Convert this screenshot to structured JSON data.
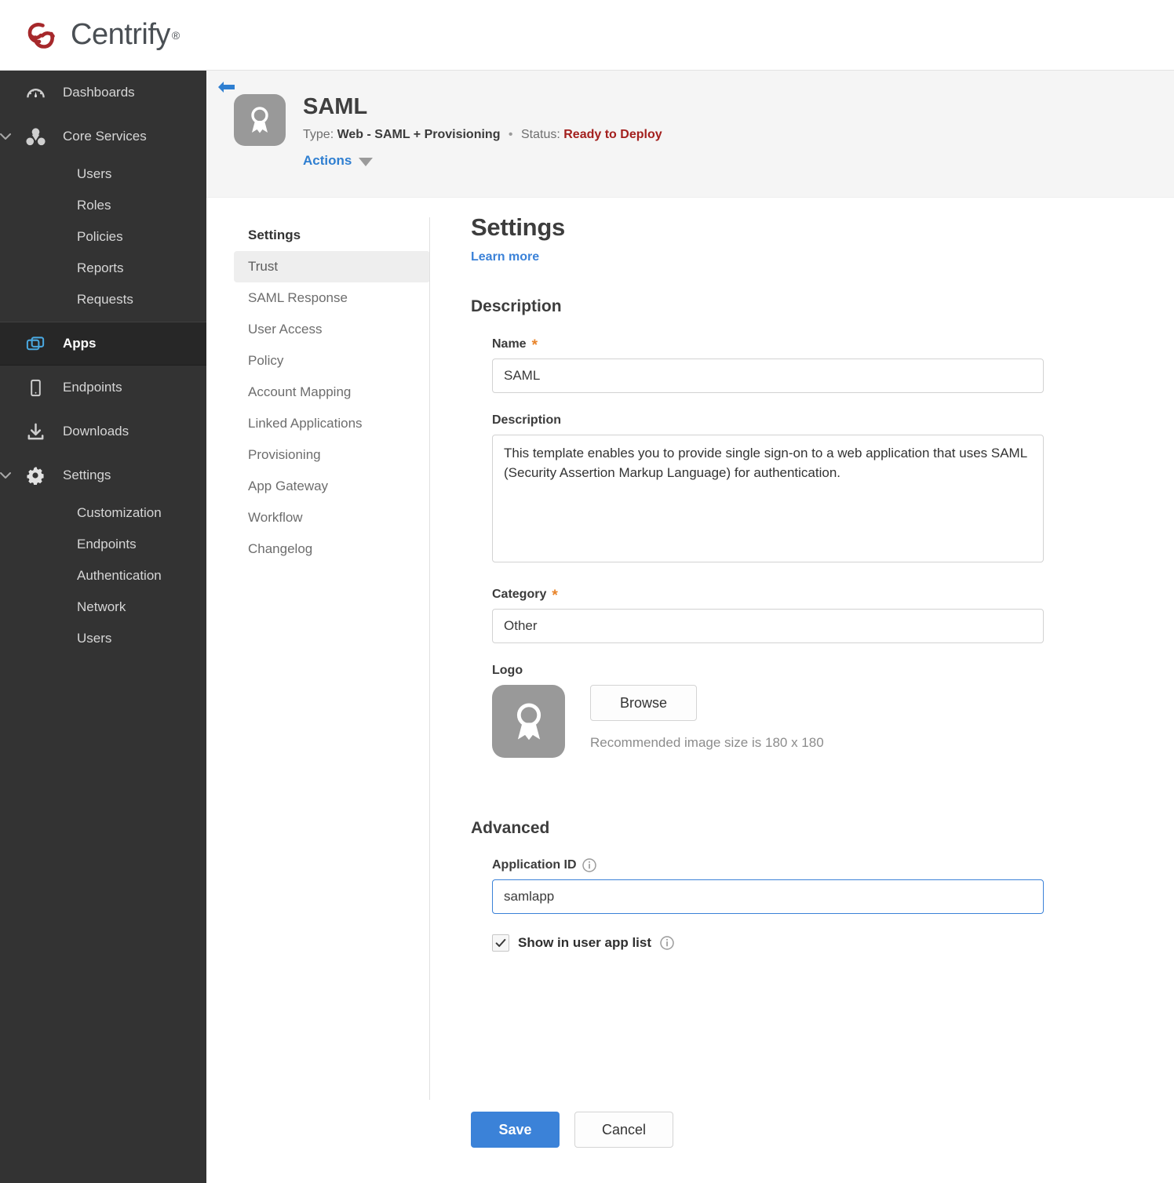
{
  "brand": {
    "name": "Centrify",
    "registered_mark": "®",
    "logo_color": "#a6282b",
    "wordmark_color": "#4a4f54"
  },
  "sidebar": {
    "items": [
      {
        "label": "Dashboards",
        "icon": "gauge-icon",
        "expandable": false,
        "active": false
      },
      {
        "label": "Core Services",
        "icon": "core-services-icon",
        "expandable": true,
        "active": false,
        "children": [
          "Users",
          "Roles",
          "Policies",
          "Reports",
          "Requests"
        ]
      },
      {
        "label": "Apps",
        "icon": "apps-icon",
        "expandable": false,
        "active": true
      },
      {
        "label": "Endpoints",
        "icon": "device-icon",
        "expandable": false,
        "active": false
      },
      {
        "label": "Downloads",
        "icon": "download-icon",
        "expandable": false,
        "active": false
      },
      {
        "label": "Settings",
        "icon": "gear-icon",
        "expandable": true,
        "active": false,
        "children": [
          "Customization",
          "Endpoints",
          "Authentication",
          "Network",
          "Users"
        ]
      }
    ]
  },
  "app_header": {
    "back_icon": "back-arrow-icon",
    "app_icon": "ribbon-award-icon",
    "title": "SAML",
    "type_label": "Type:",
    "type_value": "Web - SAML + Provisioning",
    "separator": "•",
    "status_label": "Status:",
    "status_value": "Ready to Deploy",
    "status_color": "#a3201e",
    "actions_label": "Actions"
  },
  "tabs": {
    "heading": "Settings",
    "items": [
      {
        "label": "Trust",
        "selected": true
      },
      {
        "label": "SAML Response",
        "selected": false
      },
      {
        "label": "User Access",
        "selected": false
      },
      {
        "label": "Policy",
        "selected": false
      },
      {
        "label": "Account Mapping",
        "selected": false
      },
      {
        "label": "Linked Applications",
        "selected": false
      },
      {
        "label": "Provisioning",
        "selected": false
      },
      {
        "label": "App Gateway",
        "selected": false
      },
      {
        "label": "Workflow",
        "selected": false
      },
      {
        "label": "Changelog",
        "selected": false
      }
    ]
  },
  "content": {
    "page_title": "Settings",
    "learn_more": "Learn more",
    "description_section": {
      "title": "Description",
      "name_label": "Name",
      "name_required": "*",
      "name_value": "SAML",
      "description_label": "Description",
      "description_value": "This template enables you to provide single sign-on to a web application that uses SAML (Security Assertion Markup Language) for authentication.",
      "category_label": "Category",
      "category_required": "*",
      "category_value": "Other",
      "logo_label": "Logo",
      "logo_icon": "ribbon-award-icon",
      "browse_label": "Browse",
      "recommended_text": "Recommended image size is 180 x 180"
    },
    "advanced_section": {
      "title": "Advanced",
      "app_id_label": "Application ID",
      "app_id_info_icon": "info-icon",
      "app_id_value": "samlapp",
      "app_id_focused": true,
      "show_in_app_list_label": "Show in user app list",
      "show_in_app_list_checked": true,
      "show_in_app_list_info_icon": "info-icon"
    }
  },
  "footer": {
    "save_label": "Save",
    "cancel_label": "Cancel",
    "save_color": "#3b82d8"
  }
}
